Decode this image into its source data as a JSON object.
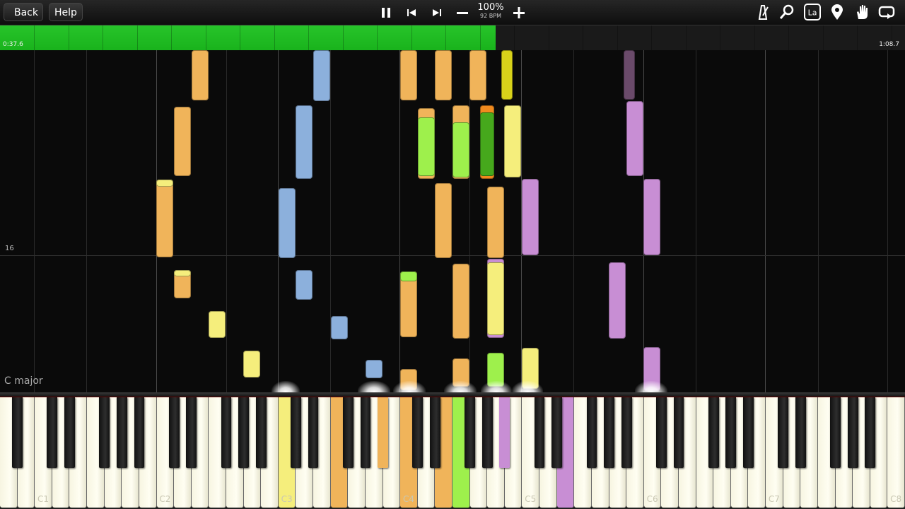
{
  "toolbar": {
    "back_label": "Back",
    "help_label": "Help",
    "speed_percent": "100%",
    "tempo": "92 BPM",
    "icons": [
      "pause-icon",
      "skip-back-icon",
      "skip-forward-icon",
      "minus-icon",
      "plus-icon",
      "metronome-icon",
      "search-icon",
      "key-label-icon",
      "marker-icon",
      "hand-icon",
      "loop-icon"
    ],
    "key_label_icon_text": "La"
  },
  "progress": {
    "elapsed": "0:37.6",
    "total": "1:08.7",
    "fraction": 0.548,
    "color": "#19b31c"
  },
  "roll": {
    "measure_number": "16",
    "key_signature": "C major"
  },
  "colors": {
    "orange": "#f0b45a",
    "yellow": "#f5ee7c",
    "blue": "#8cb0dc",
    "green": "#9ef04c",
    "darkgreen": "#46a81c",
    "olive": "#d8d21a",
    "violet": "#c88ed4",
    "darkviolet": "#6a4a6a",
    "orangered": "#f08a1e"
  },
  "keyboard": {
    "c_labels": [
      "C1",
      "C2",
      "C3",
      "C4",
      "C5",
      "C6",
      "C7",
      "C8"
    ],
    "pressed": [
      "yellow-c3",
      "orange-f3",
      "orange-a3",
      "orange-c4",
      "orange-e4",
      "green-f4",
      "violet-a4",
      "violet-e5"
    ]
  }
}
